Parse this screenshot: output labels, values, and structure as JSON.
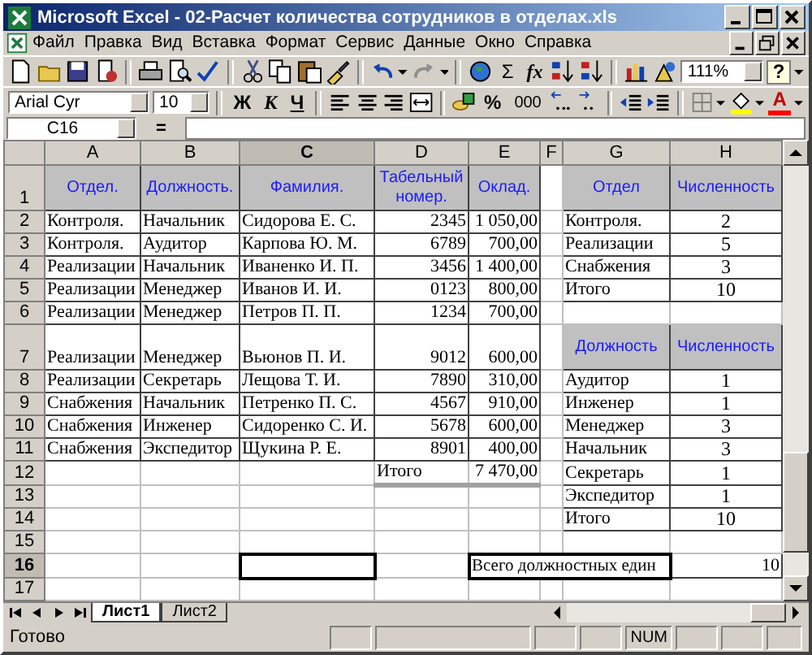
{
  "window": {
    "title": "Microsoft Excel - 02-Расчет количества сотрудников в отделах.xls"
  },
  "menu": {
    "items": [
      "Файл",
      "Правка",
      "Вид",
      "Вставка",
      "Формат",
      "Сервис",
      "Данные",
      "Окно",
      "Справка"
    ]
  },
  "toolbar_standard": {
    "sum": "Σ",
    "function": "fx",
    "zoom": "111%",
    "help": "?"
  },
  "toolbar_formatting": {
    "font": "Arial Cyr",
    "size": "10",
    "bold": "Ж",
    "italic": "К",
    "underline": "Ч",
    "percent": "%",
    "thousands": "000",
    "font_color": "A"
  },
  "formula_bar": {
    "name_box": "C16",
    "equals": "="
  },
  "sheet": {
    "columns": [
      {
        "label": "A",
        "selected": false
      },
      {
        "label": "B",
        "selected": false
      },
      {
        "label": "C",
        "selected": true
      },
      {
        "label": "D",
        "selected": false
      },
      {
        "label": "E",
        "selected": false
      },
      {
        "label": "F",
        "selected": false
      },
      {
        "label": "G",
        "selected": false
      },
      {
        "label": "H",
        "selected": false
      }
    ],
    "rows": [
      {
        "number": "1",
        "selected": false,
        "cells": [
          {
            "text": "Отдел.",
            "kind": "header"
          },
          {
            "text": "Должность.",
            "kind": "header"
          },
          {
            "text": "Фамилия.",
            "kind": "header"
          },
          {
            "text": "Табельный номер.",
            "kind": "header"
          },
          {
            "text": "Оклад.",
            "kind": "header"
          },
          null,
          {
            "text": "Отдел",
            "kind": "header"
          },
          {
            "text": "Численность",
            "kind": "header"
          }
        ]
      },
      {
        "number": "2",
        "selected": false,
        "cells": [
          {
            "text": "Контроля.",
            "kind": "text"
          },
          {
            "text": "Начальник",
            "kind": "text"
          },
          {
            "text": "Сидорова Е. С.",
            "kind": "text"
          },
          {
            "text": "2345",
            "kind": "number"
          },
          {
            "text": "1 050,00",
            "kind": "number"
          },
          null,
          {
            "text": "Контроля.",
            "kind": "text"
          },
          {
            "text": "2",
            "kind": "count"
          }
        ]
      },
      {
        "number": "3",
        "selected": false,
        "cells": [
          {
            "text": "Контроля.",
            "kind": "text"
          },
          {
            "text": "Аудитор",
            "kind": "text"
          },
          {
            "text": "Карпова Ю. М.",
            "kind": "text"
          },
          {
            "text": "6789",
            "kind": "number"
          },
          {
            "text": "700,00",
            "kind": "number"
          },
          null,
          {
            "text": "Реализации",
            "kind": "text"
          },
          {
            "text": "5",
            "kind": "count"
          }
        ]
      },
      {
        "number": "4",
        "selected": false,
        "cells": [
          {
            "text": "Реализации",
            "kind": "text"
          },
          {
            "text": "Начальник",
            "kind": "text"
          },
          {
            "text": "Иваненко И. П.",
            "kind": "text"
          },
          {
            "text": "3456",
            "kind": "number"
          },
          {
            "text": "1 400,00",
            "kind": "number"
          },
          null,
          {
            "text": "Снабжения",
            "kind": "text"
          },
          {
            "text": "3",
            "kind": "count"
          }
        ]
      },
      {
        "number": "5",
        "selected": false,
        "cells": [
          {
            "text": "Реализации",
            "kind": "text"
          },
          {
            "text": "Менеджер",
            "kind": "text"
          },
          {
            "text": "Иванов И. И.",
            "kind": "text"
          },
          {
            "text": "0123",
            "kind": "number"
          },
          {
            "text": "800,00",
            "kind": "number"
          },
          null,
          {
            "text": "Итого",
            "kind": "text"
          },
          {
            "text": "10",
            "kind": "count"
          }
        ]
      },
      {
        "number": "6",
        "selected": false,
        "cells": [
          {
            "text": "Реализации",
            "kind": "text"
          },
          {
            "text": "Менеджер",
            "kind": "text"
          },
          {
            "text": "Петров П. П.",
            "kind": "text"
          },
          {
            "text": "1234",
            "kind": "number"
          },
          {
            "text": "700,00",
            "kind": "number"
          },
          null,
          null,
          null
        ]
      },
      {
        "number": "7",
        "selected": false,
        "cells": [
          {
            "text": "Реализации",
            "kind": "text"
          },
          {
            "text": "Менеджер",
            "kind": "text"
          },
          {
            "text": "Вьюнов П. И.",
            "kind": "text"
          },
          {
            "text": "9012",
            "kind": "number"
          },
          {
            "text": "600,00",
            "kind": "number"
          },
          null,
          {
            "text": "Должность",
            "kind": "header"
          },
          {
            "text": "Численность",
            "kind": "header"
          }
        ]
      },
      {
        "number": "8",
        "selected": false,
        "cells": [
          {
            "text": "Реализации",
            "kind": "text"
          },
          {
            "text": "Секретарь",
            "kind": "text"
          },
          {
            "text": "Лещова Т. И.",
            "kind": "text"
          },
          {
            "text": "7890",
            "kind": "number"
          },
          {
            "text": "310,00",
            "kind": "number"
          },
          null,
          {
            "text": "Аудитор",
            "kind": "text"
          },
          {
            "text": "1",
            "kind": "count"
          }
        ]
      },
      {
        "number": "9",
        "selected": false,
        "cells": [
          {
            "text": "Снабжения",
            "kind": "text"
          },
          {
            "text": "Начальник",
            "kind": "text"
          },
          {
            "text": "Петренко П. С.",
            "kind": "text"
          },
          {
            "text": "4567",
            "kind": "number"
          },
          {
            "text": "910,00",
            "kind": "number"
          },
          null,
          {
            "text": "Инженер",
            "kind": "text"
          },
          {
            "text": "1",
            "kind": "count"
          }
        ]
      },
      {
        "number": "10",
        "selected": false,
        "cells": [
          {
            "text": "Снабжения",
            "kind": "text"
          },
          {
            "text": "Инженер",
            "kind": "text"
          },
          {
            "text": "Сидоренко С. И.",
            "kind": "text"
          },
          {
            "text": "5678",
            "kind": "number"
          },
          {
            "text": "600,00",
            "kind": "number"
          },
          null,
          {
            "text": "Менеджер",
            "kind": "text"
          },
          {
            "text": "3",
            "kind": "count"
          }
        ]
      },
      {
        "number": "11",
        "selected": false,
        "cells": [
          {
            "text": "Снабжения",
            "kind": "text"
          },
          {
            "text": "Экспедитор",
            "kind": "text"
          },
          {
            "text": "Щукина Р. Е.",
            "kind": "text"
          },
          {
            "text": "8901",
            "kind": "number"
          },
          {
            "text": "400,00",
            "kind": "number"
          },
          null,
          {
            "text": "Начальник",
            "kind": "text"
          },
          {
            "text": "3",
            "kind": "count"
          }
        ]
      },
      {
        "number": "12",
        "selected": false,
        "cells": [
          null,
          null,
          null,
          {
            "text": "Итого",
            "kind": "total_label"
          },
          {
            "text": "7 470,00",
            "kind": "total_value"
          },
          null,
          {
            "text": "Секретарь",
            "kind": "text"
          },
          {
            "text": "1",
            "kind": "count"
          }
        ]
      },
      {
        "number": "13",
        "selected": false,
        "cells": [
          null,
          null,
          null,
          null,
          null,
          null,
          {
            "text": "Экспедитор",
            "kind": "text"
          },
          {
            "text": "1",
            "kind": "count"
          }
        ]
      },
      {
        "number": "14",
        "selected": false,
        "cells": [
          null,
          null,
          null,
          null,
          null,
          null,
          {
            "text": "Итого",
            "kind": "text"
          },
          {
            "text": "10",
            "kind": "count"
          }
        ]
      },
      {
        "number": "15",
        "selected": false,
        "cells": [
          null,
          null,
          null,
          null,
          null,
          null,
          null,
          null
        ]
      },
      {
        "number": "16",
        "selected": true,
        "cells": [
          null,
          null,
          null,
          null,
          {
            "text": "Всего должностных един",
            "kind": "summary_label",
            "colspan": 3
          },
          {
            "text": "10",
            "kind": "number"
          }
        ]
      },
      {
        "number": "17",
        "selected": false,
        "cells": [
          null,
          null,
          null,
          null,
          null,
          null,
          null,
          null
        ]
      }
    ]
  },
  "sheet_tabs": [
    {
      "label": "Лист1",
      "selected": true
    },
    {
      "label": "Лист2",
      "selected": false
    }
  ],
  "status_bar": {
    "text": "Готово",
    "indicator": "NUM"
  }
}
